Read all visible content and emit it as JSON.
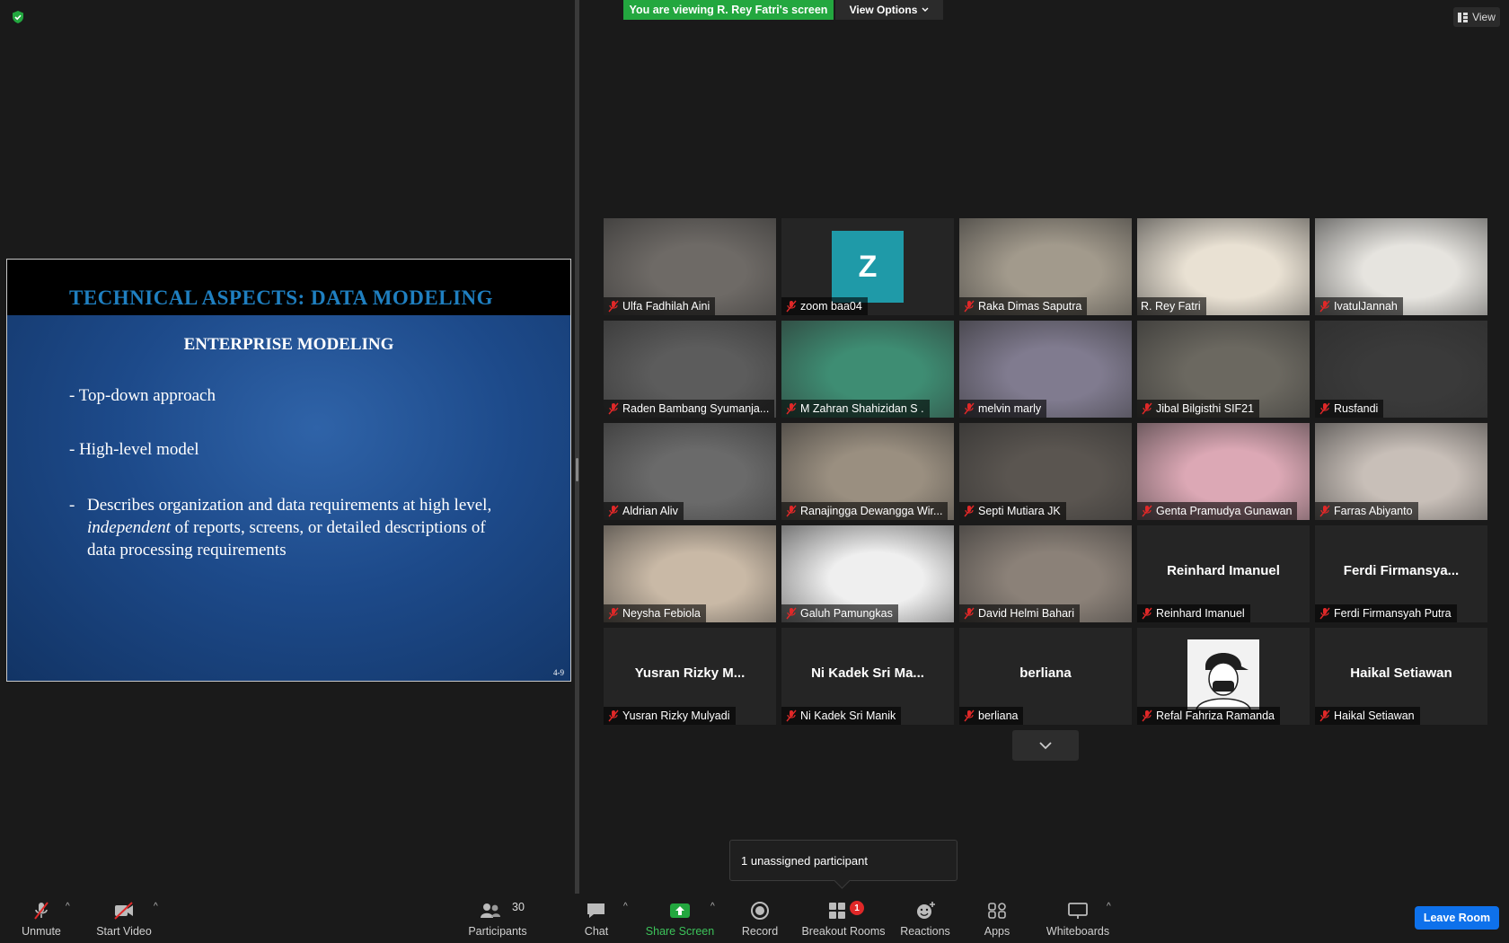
{
  "banner": {
    "viewing_text": "You are viewing R. Rey Fatri's screen",
    "view_options_label": "View Options"
  },
  "top_right": {
    "view_label": "View"
  },
  "slide": {
    "title": "TECHNICAL ASPECTS:  DATA MODELING",
    "subtitle": "ENTERPRISE MODELING",
    "bullet_1": "- Top-down approach",
    "bullet_2": "- High-level model",
    "bullet_3_dash": "-",
    "bullet_3_emphasis": "independent",
    "bullet_3_line1": "Describes organization and data requirements at high level,",
    "bullet_3_line2_rest": " of reports, screens, or detailed descriptions of",
    "bullet_3_line3": "data processing requirements",
    "page_number": "4-9"
  },
  "gallery": {
    "tiles": [
      {
        "name": "Ulfa Fadhilah Aini",
        "kind": "video",
        "tone": "#6e6a66"
      },
      {
        "name": "zoom baa04",
        "kind": "letter",
        "letter": "Z"
      },
      {
        "name": "Raka Dimas Saputra",
        "kind": "video",
        "tone": "#a29a8c"
      },
      {
        "name": "R. Rey Fatri",
        "kind": "video",
        "tone": "#e9e1d3",
        "active": true,
        "mic": false
      },
      {
        "name": "IvatulJannah",
        "kind": "video",
        "tone": "#e6e4df"
      },
      {
        "name": "Raden Bambang Syumanja...",
        "kind": "video",
        "tone": "#5c5c5c"
      },
      {
        "name": "M Zahran Shahizidan S .",
        "kind": "video",
        "tone": "#3e8d73"
      },
      {
        "name": "melvin marly",
        "kind": "video",
        "tone": "#807b8f"
      },
      {
        "name": "Jibal Bilgisthi SIF21",
        "kind": "video",
        "tone": "#6b6860"
      },
      {
        "name": "Rusfandi",
        "kind": "video",
        "tone": "#3a3a3a"
      },
      {
        "name": "Aldrian Aliv",
        "kind": "video",
        "tone": "#6a6a6a"
      },
      {
        "name": "Ranajingga Dewangga Wir...",
        "kind": "video",
        "tone": "#9a8f80"
      },
      {
        "name": "Septi Mutiara JK",
        "kind": "video",
        "tone": "#5a5550"
      },
      {
        "name": "Genta Pramudya Gunawan",
        "kind": "video",
        "tone": "#dca8b5"
      },
      {
        "name": "Farras Abiyanto",
        "kind": "video",
        "tone": "#c8bfb8"
      },
      {
        "name": "Neysha Febiola",
        "kind": "video",
        "tone": "#c9b9a6"
      },
      {
        "name": "Galuh Pamungkas",
        "kind": "video",
        "tone": "#efefef"
      },
      {
        "name": "David Helmi Bahari",
        "kind": "video",
        "tone": "#8b8178"
      },
      {
        "name": "Reinhard Imanuel",
        "kind": "text",
        "display": "Reinhard Imanuel"
      },
      {
        "name": "Ferdi Firmansyah Putra",
        "kind": "text",
        "display": "Ferdi  Firmansya..."
      },
      {
        "name": "Yusran Rizky Mulyadi",
        "kind": "text",
        "display": "Yusran  Rizky  M..."
      },
      {
        "name": "Ni Kadek Sri Manik",
        "kind": "text",
        "display": "Ni Kadek Sri Ma..."
      },
      {
        "name": "berliana",
        "kind": "text",
        "display": "berliana"
      },
      {
        "name": "Refal Fahriza Ramanda",
        "kind": "avatar"
      },
      {
        "name": "Haikal Setiawan",
        "kind": "text",
        "display": "Haikal Setiawan"
      }
    ]
  },
  "popup": {
    "text": "1 unassigned participant"
  },
  "toolbar": {
    "unmute": "Unmute",
    "start_video": "Start Video",
    "participants": "Participants",
    "participants_count": "30",
    "chat": "Chat",
    "share_screen": "Share Screen",
    "record": "Record",
    "breakout_rooms": "Breakout Rooms",
    "breakout_badge": "1",
    "reactions": "Reactions",
    "apps": "Apps",
    "whiteboards": "Whiteboards",
    "leave_room": "Leave Room"
  },
  "colors": {
    "share_green": "#23a73f",
    "leave_blue": "#0e71eb",
    "active_speaker": "#d6e23a",
    "mic_muted": "#e02828"
  }
}
